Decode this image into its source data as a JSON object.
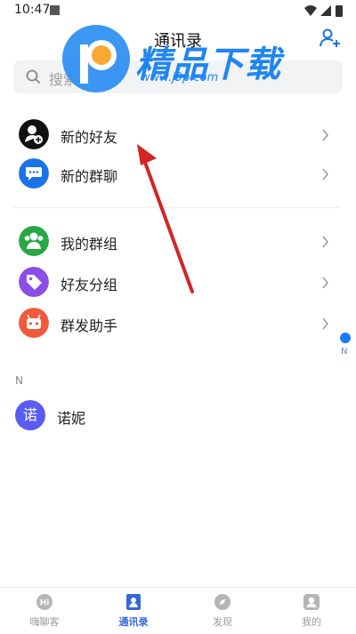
{
  "status_bar": {
    "time": "10:47"
  },
  "header": {
    "title": "通讯录"
  },
  "watermark": {
    "brand_text": "精品下载",
    "url": "www.j9p.com"
  },
  "search": {
    "placeholder": "搜索"
  },
  "menu": {
    "items": [
      {
        "label": "新的好友",
        "color": "#111111",
        "icon": "user-add-icon"
      },
      {
        "label": "新的群聊",
        "color": "#1a73e8",
        "icon": "chat-bubble-icon"
      }
    ]
  },
  "groups": {
    "items": [
      {
        "label": "我的群组",
        "color": "#27a845",
        "icon": "group-icon"
      },
      {
        "label": "好友分组",
        "color": "#8b4fe8",
        "icon": "tag-icon"
      },
      {
        "label": "群发助手",
        "color": "#ef5a3c",
        "icon": "robot-icon"
      }
    ]
  },
  "contacts": {
    "index_letter": "N",
    "items": [
      {
        "avatar_char": "诺",
        "name": "诺妮",
        "color": "#5b5cf2"
      }
    ]
  },
  "alpha_index": {
    "letters": [
      "N"
    ]
  },
  "tabbar": {
    "tabs": [
      {
        "label": "嗨聊客",
        "icon": "hi-chat-icon",
        "active": false
      },
      {
        "label": "通讯录",
        "icon": "contacts-icon",
        "active": true
      },
      {
        "label": "发现",
        "icon": "compass-icon",
        "active": false
      },
      {
        "label": "我的",
        "icon": "profile-icon",
        "active": false
      }
    ]
  },
  "colors": {
    "accent": "#3568d6",
    "annotation_arrow": "#d42424"
  }
}
